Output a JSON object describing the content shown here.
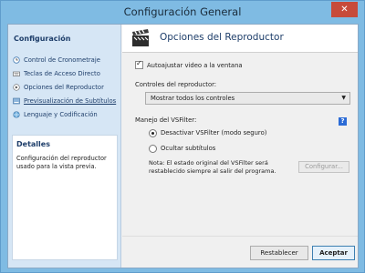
{
  "window": {
    "title": "Configuración General",
    "close_glyph": "✕"
  },
  "sidebar": {
    "title": "Configuración",
    "items": [
      {
        "label": "Control de Cronometraje",
        "icon": "clock-icon"
      },
      {
        "label": "Teclas de Acceso Directo",
        "icon": "keyboard-icon"
      },
      {
        "label": "Opciones del Reproductor",
        "icon": "player-icon"
      },
      {
        "label": "Previsualización de Subtítulos",
        "icon": "preview-icon",
        "selected": true
      },
      {
        "label": "Lenguaje y Codificación",
        "icon": "globe-icon"
      }
    ],
    "details": {
      "title": "Detalles",
      "text": "Configuración del reproductor usado para la vista previa."
    }
  },
  "panel": {
    "title": "Opciones del Reproductor",
    "autosize_label": "Autoajustar video a la ventana",
    "controls_label": "Controles del reproductor:",
    "controls_value": "Mostrar todos los controles",
    "vsfilter_label": "Manejo del VSFilter:",
    "radio1": "Desactivar VSFilter (modo seguro)",
    "radio2": "Ocultar subtítulos",
    "note": "Nota: El estado original del VSFilter será restablecido siempre al salir del programa.",
    "config_button": "Configurar..."
  },
  "footer": {
    "reset": "Restablecer",
    "accept": "Aceptar"
  },
  "colors": {
    "accent": "#1e3e6a",
    "sidebar_bg": "#d6e6f5",
    "close": "#c74b3a"
  }
}
